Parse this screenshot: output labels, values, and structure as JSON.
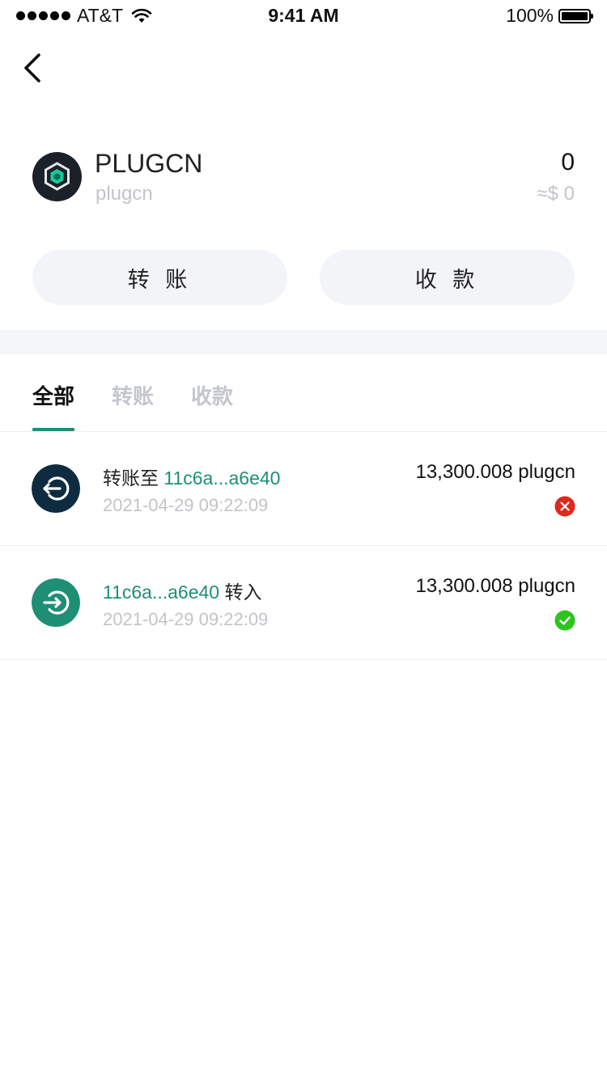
{
  "status_bar": {
    "carrier": "AT&T",
    "time": "9:41 AM",
    "battery": "100%"
  },
  "token": {
    "name": "PLUGCN",
    "symbol": "plugcn",
    "balance": "0",
    "usd_value": "≈$ 0"
  },
  "actions": {
    "send_label": "转 账",
    "receive_label": "收 款"
  },
  "tabs": [
    {
      "label": "全部",
      "active": true
    },
    {
      "label": "转账",
      "active": false
    },
    {
      "label": "收款",
      "active": false
    }
  ],
  "transactions": [
    {
      "prefix": "转账至 ",
      "address": "11c6a...a6e40",
      "suffix": "",
      "time": "2021-04-29 09:22:09",
      "amount": "13,300.008 plugcn",
      "status": "failed",
      "icon": "outgoing-icon"
    },
    {
      "prefix": "",
      "address": "11c6a...a6e40",
      "suffix": " 转入",
      "time": "2021-04-29 09:22:09",
      "amount": "13,300.008 plugcn",
      "status": "success",
      "icon": "incoming-icon"
    }
  ],
  "colors": {
    "accent": "#1e8f74",
    "dark_icon": "#0f2b40",
    "failed": "#e0281c",
    "success": "#2cc41f",
    "muted": "#c2c4c8"
  }
}
